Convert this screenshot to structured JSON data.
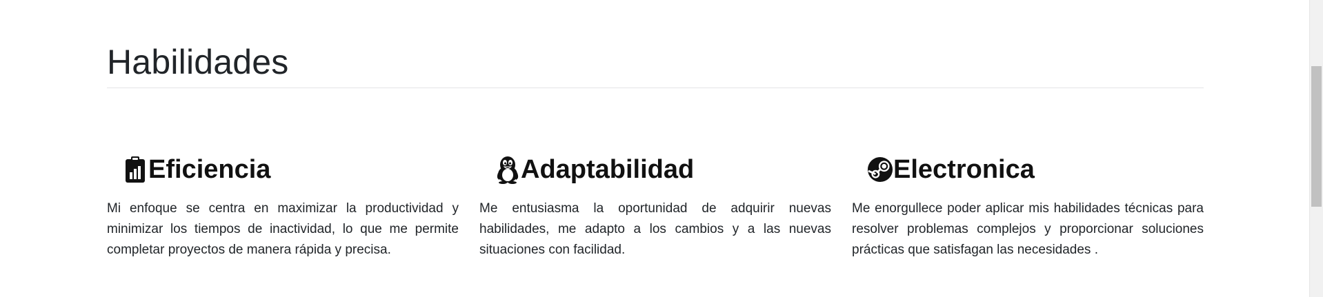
{
  "section": {
    "title": "Habilidades"
  },
  "skills": [
    {
      "icon": "clipboard-chart-icon",
      "title": "Eficiencia",
      "text": "Mi enfoque se centra en maximizar la productividad y minimizar los tiempos de inactividad, lo que me permite completar proyectos de manera rápida y precisa."
    },
    {
      "icon": "penguin-icon",
      "title": "Adaptabilidad",
      "text": "Me entusiasma la oportunidad de adquirir nuevas habilidades, me adapto a los cambios y a las nuevas situaciones con facilidad."
    },
    {
      "icon": "steam-icon",
      "title": "Electronica",
      "text": "Me enorgullece poder aplicar mis habilidades técnicas para resolver problemas complejos y proporcionar soluciones prácticas que satisfagan las necesidades ."
    }
  ],
  "colors": {
    "text": "#212529",
    "heading": "#111111",
    "rule": "#e3e4e6",
    "scrollbar_track": "#f1f1f1",
    "scrollbar_thumb": "#c1c1c1"
  }
}
